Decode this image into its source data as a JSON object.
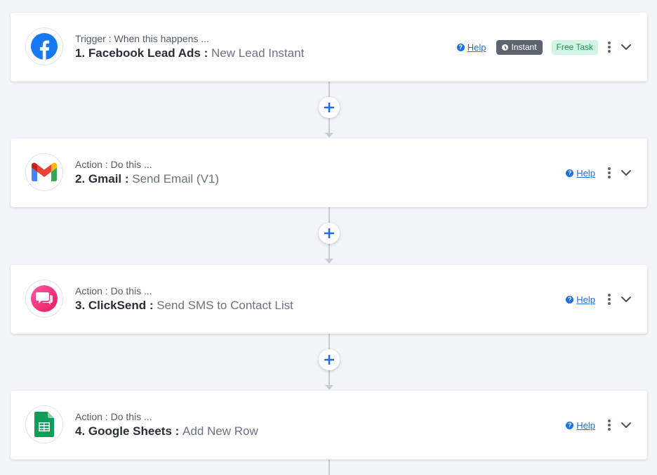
{
  "steps": [
    {
      "subtitle": "Trigger : When this happens ...",
      "app": "1. Facebook Lead Ads :",
      "event": "New Lead Instant",
      "help": "Help",
      "instant_badge": "Instant",
      "free_badge": "Free Task",
      "icon": "facebook-icon"
    },
    {
      "subtitle": "Action : Do this ...",
      "app": "2. Gmail :",
      "event": "Send Email (V1)",
      "help": "Help",
      "icon": "gmail-icon"
    },
    {
      "subtitle": "Action : Do this ...",
      "app": "3. ClickSend :",
      "event": "Send SMS to Contact List",
      "help": "Help",
      "icon": "clicksend-icon"
    },
    {
      "subtitle": "Action : Do this ...",
      "app": "4. Google Sheets :",
      "event": "Add New Row",
      "help": "Help",
      "icon": "google-sheets-icon"
    }
  ],
  "colors": {
    "background": "#f2f4f7",
    "link": "#1f6fe0",
    "instant_badge": "#5d6470",
    "free_badge_bg": "#d2f5e3",
    "free_badge_text": "#1f8a56"
  }
}
